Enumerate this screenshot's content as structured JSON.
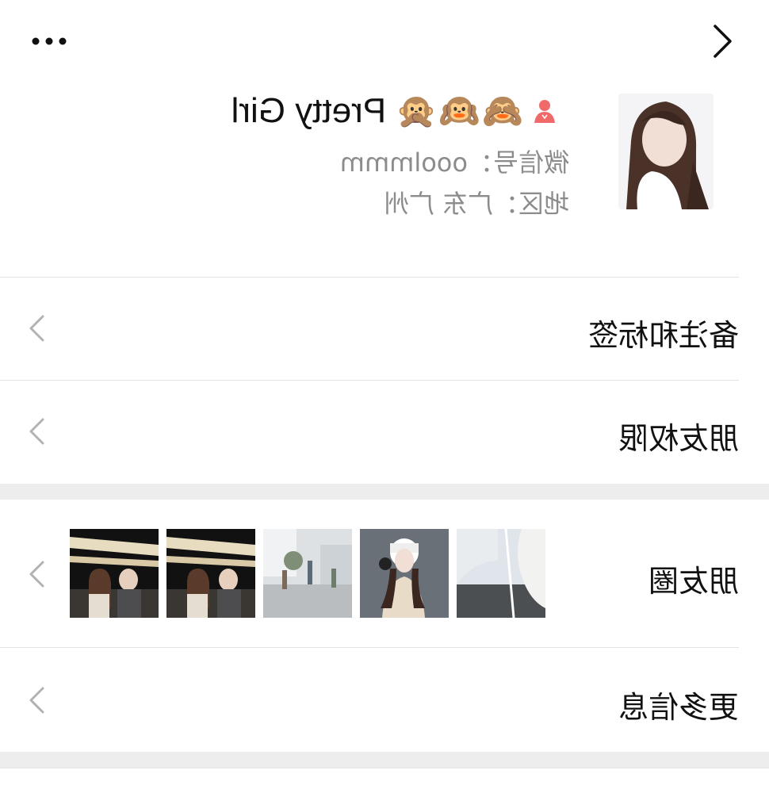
{
  "header": {
    "back_icon": "chevron-back-icon",
    "more_icon": "more-dots-icon"
  },
  "profile": {
    "name": "Pretty Girl",
    "name_emojis": "🙈🙉🙊",
    "gender_icon": "female-icon",
    "wechat_id": "微信号：ooolmmm",
    "region": "地区：广东 广州"
  },
  "rows": {
    "remark": {
      "label": "备注和标签"
    },
    "permission": {
      "label": "朋友权限"
    },
    "moments": {
      "label": "朋友圈"
    },
    "more": {
      "label": "更多信息"
    }
  },
  "colors": {
    "background": "#ffffff",
    "separator": "#ededed",
    "secondary_text": "#8c8c8c",
    "female_icon": "#f06a6a"
  }
}
